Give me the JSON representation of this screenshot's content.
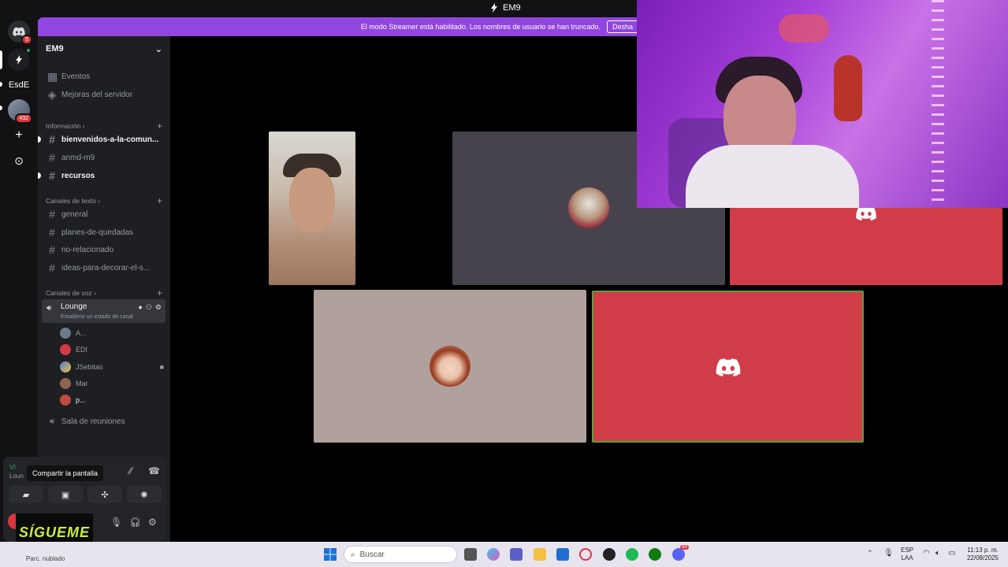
{
  "window": {
    "title": "EM9"
  },
  "streamer": {
    "message": "El modo Streamer está habilitado. Los nombres de usuario se han truncado.",
    "button": "Desha"
  },
  "guilds": {
    "dm_badge": "5",
    "esde_label": "EsdE",
    "server_badge": "432",
    "add_label": "+",
    "discover_label": "⊙"
  },
  "server": {
    "name": "EM9",
    "events": "Eventos",
    "boost": "Mejoras del servidor",
    "categories": {
      "info": "Información",
      "text": "Canales de texto",
      "voice": "Canales de voz"
    },
    "info_channels": [
      "bienvenidos-a-la-comun...",
      "anmd-m9",
      "recursos"
    ],
    "text_channels": [
      "general",
      "planes-de-quedadas",
      "no-relacionado",
      "ideas-para-decorar-el-s..."
    ],
    "voice_channel": {
      "name": "Lounge",
      "status": "Establece un estado de canal"
    },
    "voice_users": [
      "A...",
      "EDI",
      "JSebitas",
      "Mar",
      "p..."
    ],
    "meeting_room": "Sala de reuniones"
  },
  "panel": {
    "connection": "Vi",
    "channel": "Loun",
    "tooltip": "Compartir la pantalla",
    "overlay": "SÍGUEME"
  },
  "taskbar": {
    "weather": "Parc. nublado",
    "search_placeholder": "Buscar",
    "lang_top": "ESP",
    "lang_bottom": "LAA",
    "time": "11:13 p. m.",
    "date": "22/08/2025",
    "notif_badge": "99"
  },
  "colors": {
    "accent": "#9146e0",
    "discord_red": "#d13c49",
    "stage_gray": "#46434c",
    "tile_beige": "#b1a19c"
  }
}
